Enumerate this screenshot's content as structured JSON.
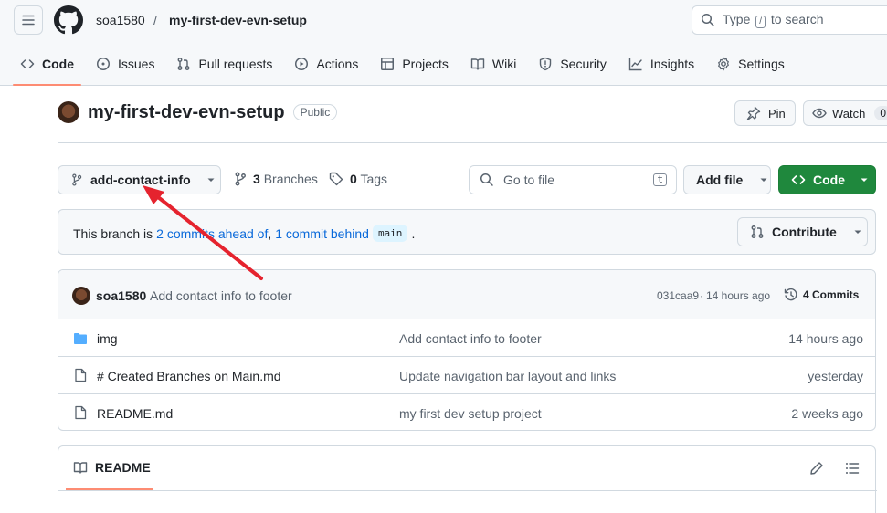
{
  "header": {
    "owner": "soa1580",
    "separator": "/",
    "repo": "my-first-dev-evn-setup",
    "search": {
      "prefix": "Type",
      "key": "/",
      "suffix": "to search"
    }
  },
  "nav": {
    "tabs": [
      {
        "label": "Code",
        "icon": "code-icon",
        "active": true
      },
      {
        "label": "Issues",
        "icon": "issue-icon"
      },
      {
        "label": "Pull requests",
        "icon": "pull-request-icon"
      },
      {
        "label": "Actions",
        "icon": "play-icon"
      },
      {
        "label": "Projects",
        "icon": "table-icon"
      },
      {
        "label": "Wiki",
        "icon": "book-icon"
      },
      {
        "label": "Security",
        "icon": "shield-icon"
      },
      {
        "label": "Insights",
        "icon": "graph-icon"
      },
      {
        "label": "Settings",
        "icon": "gear-icon"
      }
    ]
  },
  "repo": {
    "name": "my-first-dev-evn-setup",
    "visibility": "Public",
    "pin_label": "Pin",
    "watch_label": "Watch",
    "watch_count": "0"
  },
  "toolbar": {
    "branch": "add-contact-info",
    "branches_count": "3",
    "branches_label": "Branches",
    "tags_count": "0",
    "tags_label": "Tags",
    "goto_placeholder": "Go to file",
    "goto_key": "t",
    "add_file_label": "Add file",
    "code_label": "Code"
  },
  "branch_status": {
    "prefix": "This branch is",
    "ahead": "2 commits ahead of",
    "comma": ",",
    "behind": "1 commit behind",
    "base": "main",
    "period": ".",
    "contribute_label": "Contribute"
  },
  "latest_commit": {
    "author": "soa1580",
    "message": "Add contact info to footer",
    "hash": "031caa9",
    "dot": "·",
    "time": "14 hours ago",
    "commits_label": "4 Commits"
  },
  "files": [
    {
      "type": "folder",
      "name": "img",
      "message": "Add contact info to footer",
      "time": "14 hours ago"
    },
    {
      "type": "file",
      "name": "# Created Branches on Main.md",
      "message": "Update navigation bar layout and links",
      "time": "yesterday"
    },
    {
      "type": "file",
      "name": "README.md",
      "message": "my first dev setup project",
      "time": "2 weeks ago"
    }
  ],
  "readme": {
    "title": "README"
  },
  "colors": {
    "accent": "#fd8c73",
    "link": "#0969da",
    "green": "#1f883d",
    "arrow": "#e5232e",
    "folder": "#54aeff"
  }
}
